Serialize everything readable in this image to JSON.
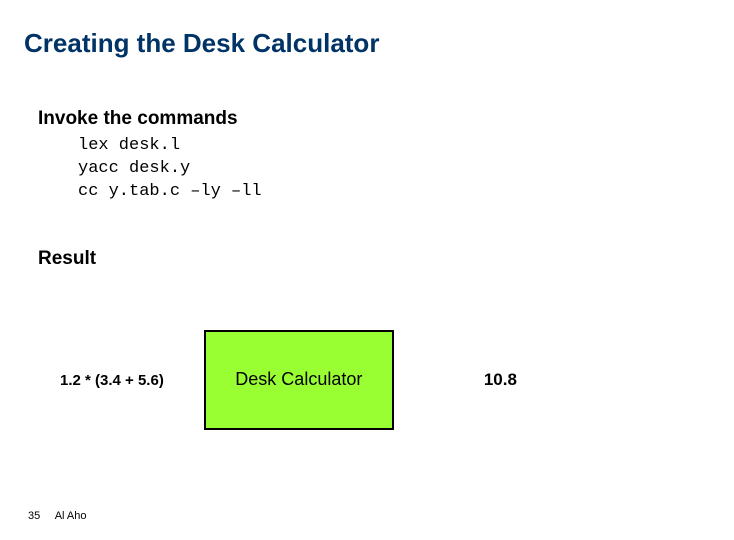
{
  "title": "Creating the Desk Calculator",
  "sections": {
    "invoke": {
      "heading": "Invoke the commands",
      "code": "lex desk.l\nyacc desk.y\ncc y.tab.c –ly –ll"
    },
    "result": {
      "heading": "Result",
      "diagram": {
        "input": "1.2 * (3.4 + 5.6)",
        "box_label": "Desk\nCalculator",
        "output": "10.8"
      }
    }
  },
  "footer": {
    "page_number": "35",
    "author": "Al Aho"
  }
}
